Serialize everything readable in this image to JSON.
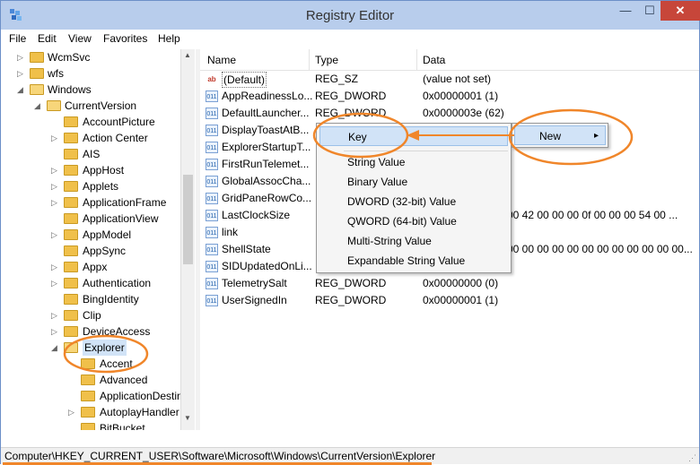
{
  "window": {
    "title": "Registry Editor"
  },
  "titlebar": {
    "minimize": "—",
    "maximize": "☐",
    "close": "✕"
  },
  "menu": [
    "File",
    "Edit",
    "View",
    "Favorites",
    "Help"
  ],
  "tree": {
    "items": [
      {
        "label": "WcmSvc",
        "expander": "▷"
      },
      {
        "label": "wfs",
        "expander": "▷"
      },
      {
        "label": "Windows",
        "expander": "◢"
      },
      {
        "label": "CurrentVersion",
        "expander": "◢"
      },
      {
        "label": "AccountPicture",
        "expander": ""
      },
      {
        "label": "Action Center",
        "expander": "▷"
      },
      {
        "label": "AIS",
        "expander": ""
      },
      {
        "label": "AppHost",
        "expander": "▷"
      },
      {
        "label": "Applets",
        "expander": "▷"
      },
      {
        "label": "ApplicationFrame",
        "expander": "▷"
      },
      {
        "label": "ApplicationView",
        "expander": ""
      },
      {
        "label": "AppModel",
        "expander": "▷"
      },
      {
        "label": "AppSync",
        "expander": ""
      },
      {
        "label": "Appx",
        "expander": "▷"
      },
      {
        "label": "Authentication",
        "expander": "▷"
      },
      {
        "label": "BingIdentity",
        "expander": ""
      },
      {
        "label": "Clip",
        "expander": "▷"
      },
      {
        "label": "DeviceAccess",
        "expander": "▷"
      },
      {
        "label": "Explorer",
        "expander": "◢"
      },
      {
        "label": "Accent",
        "expander": ""
      },
      {
        "label": "Advanced",
        "expander": ""
      },
      {
        "label": "ApplicationDestin",
        "expander": ""
      },
      {
        "label": "AutoplayHandler",
        "expander": "▷"
      },
      {
        "label": "BitBucket",
        "expander": ""
      }
    ]
  },
  "list": {
    "headers": {
      "name": "Name",
      "type": "Type",
      "data": "Data"
    },
    "rows": [
      {
        "icon": "ab",
        "name": "(Default)",
        "type": "REG_SZ",
        "data": "(value not set)"
      },
      {
        "icon": "011",
        "name": "AppReadinessLo...",
        "type": "REG_DWORD",
        "data": "0x00000001 (1)"
      },
      {
        "icon": "011",
        "name": "DefaultLauncher...",
        "type": "REG_DWORD",
        "data": "0x0000003e (62)"
      },
      {
        "icon": "011",
        "name": "DisplayToastAtB...",
        "type": "",
        "data": ""
      },
      {
        "icon": "011",
        "name": "ExplorerStartupT...",
        "type": "",
        "data": ""
      },
      {
        "icon": "011",
        "name": "FirstRunTelemet...",
        "type": "",
        "data": ""
      },
      {
        "icon": "011",
        "name": "GlobalAssocCha...",
        "type": "",
        "data": ""
      },
      {
        "icon": "011",
        "name": "GridPaneRowCo...",
        "type": "",
        "data": ""
      },
      {
        "icon": "011",
        "name": "LastClockSize",
        "type": "",
        "data": "00 42 00 00 00 0f 00 00 00 54 00 ..."
      },
      {
        "icon": "011",
        "name": "link",
        "type": "",
        "data": ""
      },
      {
        "icon": "011",
        "name": "ShellState",
        "type": "",
        "data": "00 00 00 00 00 00 00 00 00 00 00 00..."
      },
      {
        "icon": "011",
        "name": "SIDUpdatedOnLi...",
        "type": "",
        "data": ""
      },
      {
        "icon": "011",
        "name": "TelemetrySalt",
        "type": "REG_DWORD",
        "data": "0x00000000 (0)"
      },
      {
        "icon": "011",
        "name": "UserSignedIn",
        "type": "REG_DWORD",
        "data": "0x00000001 (1)"
      }
    ]
  },
  "context_menu": {
    "new_label": "New",
    "new_arrow": "▸",
    "key_label": "Key",
    "items": [
      "String Value",
      "Binary Value",
      "DWORD (32-bit) Value",
      "QWORD (64-bit) Value",
      "Multi-String Value",
      "Expandable String Value"
    ]
  },
  "statusbar": {
    "path": "Computer\\HKEY_CURRENT_USER\\Software\\Microsoft\\Windows\\CurrentVersion\\Explorer"
  },
  "colors": {
    "annotation": "#f0862a",
    "selection": "#d1e3f7",
    "titlebar": "#b8cdec",
    "close": "#c7463a"
  }
}
